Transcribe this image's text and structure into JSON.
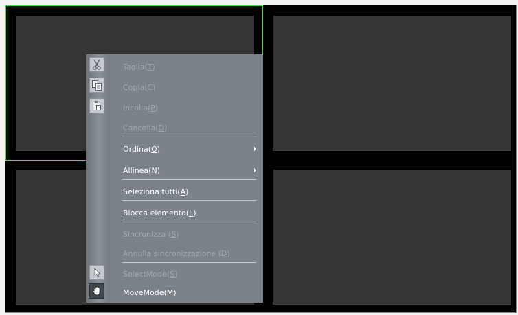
{
  "menu": {
    "items": [
      {
        "pre": "Taglia(",
        "key": "T",
        "post": ")",
        "enabled": false
      },
      {
        "pre": "Copia(",
        "key": "C",
        "post": ")",
        "enabled": false
      },
      {
        "pre": "Incolla(",
        "key": "P",
        "post": ")",
        "enabled": false
      },
      {
        "pre": "Cancella(",
        "key": "D",
        "post": ")",
        "enabled": false
      },
      {
        "pre": "Ordina(",
        "key": "O",
        "post": ")",
        "enabled": true
      },
      {
        "pre": "Allinea(",
        "key": "N",
        "post": ")",
        "enabled": true
      },
      {
        "pre": "Seleziona tutti(",
        "key": "A",
        "post": ")",
        "enabled": true
      },
      {
        "pre": "Blocca elemento(",
        "key": "L",
        "post": ")",
        "enabled": true
      },
      {
        "pre": "Sincronizza (",
        "key": "S",
        "post": ")",
        "enabled": false
      },
      {
        "pre": "Annulla sincronizzazione (",
        "key": "D",
        "post": ")",
        "enabled": false
      },
      {
        "pre": "SelectMode(",
        "key": "S",
        "post": ")",
        "enabled": false
      },
      {
        "pre": "MoveMode(",
        "key": "M",
        "post": ")",
        "enabled": true
      }
    ]
  },
  "icons": {
    "cut": "scissors-icon",
    "copy": "copy-icon",
    "paste": "paste-icon",
    "select_mode": "cursor-arrow-icon",
    "move_mode": "hand-icon"
  },
  "colors": {
    "selection_border": "#3ddc3d",
    "menu_bg": "#7c8289",
    "pane_bg": "#353535",
    "canvas_bg": "#000000"
  }
}
